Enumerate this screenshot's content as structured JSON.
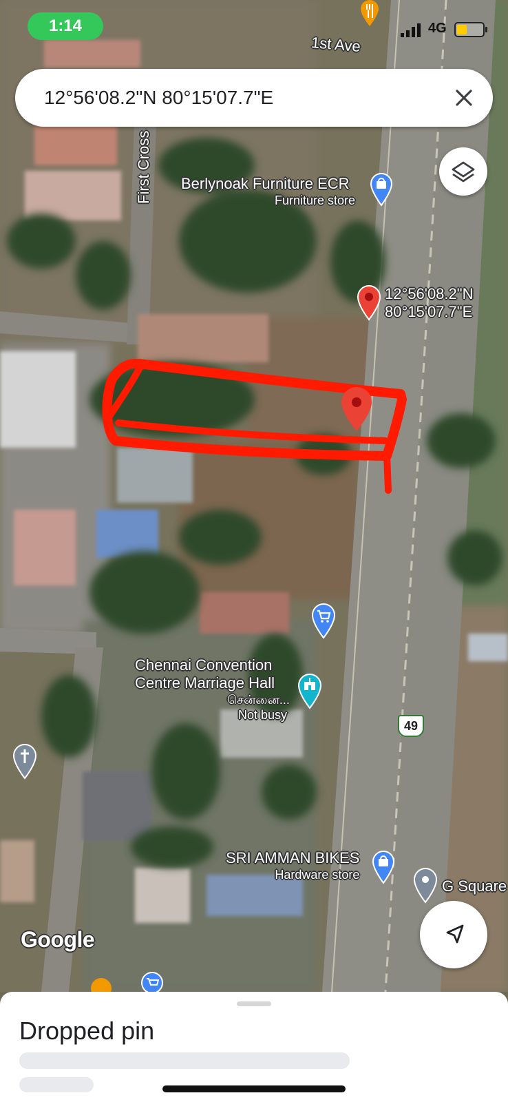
{
  "status_bar": {
    "time": "1:14",
    "network": "4G",
    "battery_level": 0.35
  },
  "search": {
    "value": "12°56'08.2\"N 80°15'07.7\"E"
  },
  "map": {
    "streets": {
      "first_ave": "1st Ave",
      "first_cross": "First Cross"
    },
    "pois": [
      {
        "name": "Berlynoak Furniture ECR",
        "category": "Furniture store",
        "icon": "shopping-bag-icon",
        "color": "#4285f4"
      },
      {
        "name": "Chennai Convention Centre Marriage Hall",
        "name_line1": "Chennai Convention",
        "name_line2": "Centre Marriage Hall",
        "tamil": "சென்னை...",
        "busy": "Not busy",
        "icon": "event-hall-icon",
        "color": "#12b5cb"
      },
      {
        "name": "SRI AMMAN BIKES",
        "category": "Hardware store",
        "icon": "shopping-bag-icon",
        "color": "#4285f4"
      },
      {
        "name": "G Square",
        "icon": "place-icon",
        "color": "#7c8a9a"
      }
    ],
    "pin_label_line1": "12°56'08.2\"N",
    "pin_label_line2": "80°15'07.7\"E",
    "highway_shield": "49",
    "logo": "Google"
  },
  "sheet": {
    "title": "Dropped pin"
  },
  "colors": {
    "pin_red": "#ea4335",
    "annotation_red": "#ff1a00",
    "status_green": "#34c759"
  }
}
